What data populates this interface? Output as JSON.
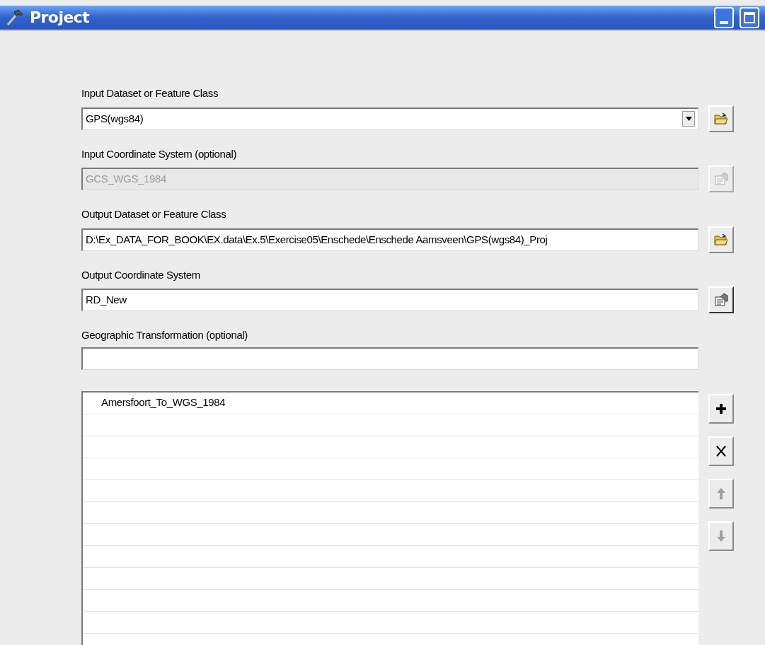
{
  "window": {
    "title": "Project"
  },
  "parameters": [
    {
      "label": "Input Dataset or Feature Class",
      "value": "GPS(wgs84)",
      "kind": "dropdown",
      "disabled": false,
      "button": {
        "kind": "browse"
      }
    },
    {
      "label": "Input Coordinate System (optional)",
      "value": "GCS_WGS_1984",
      "kind": "text",
      "disabled": true,
      "button": {
        "kind": "properties"
      }
    },
    {
      "label": "Output Dataset or Feature Class",
      "value": "D:\\Ex_DATA_FOR_BOOK\\EX.data\\Ex.5\\Exercise05\\Enschede\\Enschede Aamsveen\\GPS(wgs84)_Proj",
      "kind": "text",
      "disabled": false,
      "button": {
        "kind": "browse"
      }
    },
    {
      "label": "Output Coordinate System",
      "value": "RD_New",
      "kind": "text",
      "disabled": false,
      "button": {
        "kind": "properties"
      }
    },
    {
      "label": "Geographic Transformation (optional)",
      "kind": "text",
      "disabled": false
    }
  ],
  "transformations": {
    "items": [
      {
        "label": "Amersfoort_To_WGS_1984"
      }
    ],
    "buttons": [
      {
        "kind": "add",
        "disabled": false
      },
      {
        "kind": "remove",
        "disabled": false
      },
      {
        "kind": "up",
        "disabled": true
      },
      {
        "kind": "down",
        "disabled": true
      }
    ]
  }
}
